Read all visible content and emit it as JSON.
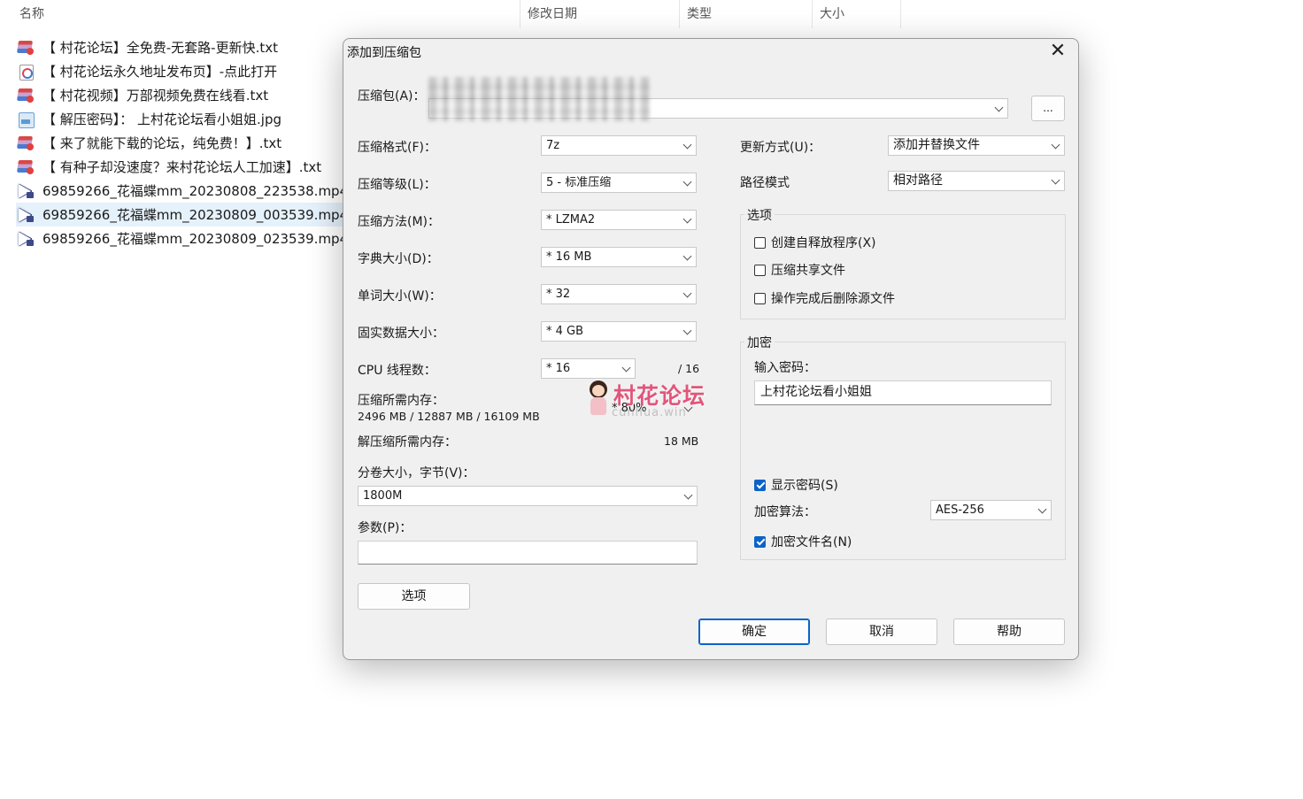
{
  "explorer": {
    "columns": [
      "名称",
      "修改日期",
      "类型",
      "大小"
    ],
    "files": [
      {
        "icon": "rar",
        "name": "【 村花论坛】全免费-无套路-更新快.txt"
      },
      {
        "icon": "html",
        "name": "【 村花论坛永久地址发布页】-点此打开"
      },
      {
        "icon": "rar",
        "name": "【 村花视频】万部视频免费在线看.txt"
      },
      {
        "icon": "jpg",
        "name": "【 解压密码】： 上村花论坛看小姐姐.jpg"
      },
      {
        "icon": "rar",
        "name": "【 来了就能下载的论坛，纯免费！】.txt"
      },
      {
        "icon": "rar",
        "name": "【 有种子却没速度？来村花论坛人工加速】.txt"
      },
      {
        "icon": "mp4",
        "name": "69859266_花福蝶mm_20230808_223538.mp4"
      },
      {
        "icon": "mp4",
        "name": "69859266_花福蝶mm_20230809_003539.mp4",
        "selected": true
      },
      {
        "icon": "mp4",
        "name": "69859266_花福蝶mm_20230809_023539.mp4"
      }
    ]
  },
  "dialog": {
    "title": "添加到压缩包",
    "archive_label": "压缩包(A)：",
    "browse_label": "...",
    "format_label": "压缩格式(F)：",
    "format_value": "7z",
    "level_label": "压缩等级(L)：",
    "level_value": "5 - 标准压缩",
    "method_label": "压缩方法(M)：",
    "method_value": "*  LZMA2",
    "dict_label": "字典大小(D)：",
    "dict_value": "*  16 MB",
    "word_label": "单词大小(W)：",
    "word_value": "*  32",
    "solid_label": "固实数据大小：",
    "solid_value": "*  4 GB",
    "cpu_label": "CPU 线程数：",
    "cpu_value": "*  16",
    "cpu_total": "/ 16",
    "mem_label": "压缩所需内存：",
    "mem_value": "2496 MB / 12887 MB / 16109 MB",
    "mem_percent": "* 80%",
    "decomp_label": "解压缩所需内存：",
    "decomp_value": "18 MB",
    "volume_label": "分卷大小，字节(V)：",
    "volume_value": "1800M",
    "params_label": "参数(P)：",
    "params_value": "",
    "options_button": "选项",
    "update_label": "更新方式(U)：",
    "update_value": "添加并替换文件",
    "path_label": "路径模式",
    "path_value": "相对路径",
    "options_group": "选项",
    "opt_sfx": "创建自释放程序(X)",
    "opt_shared": "压缩共享文件",
    "opt_delete": "操作完成后删除源文件",
    "enc_group": "加密",
    "pwd_label": "输入密码：",
    "pwd_value": "上村花论坛看小姐姐",
    "show_pwd": "显示密码(S)",
    "algo_label": "加密算法：",
    "algo_value": "AES-256",
    "enc_names": "加密文件名(N)",
    "ok": "确定",
    "cancel": "取消",
    "help": "帮助"
  },
  "watermark": {
    "text": "村花论坛",
    "sub": "cunhua.win"
  },
  "colors": {
    "accent": "#0a64c8",
    "dialog_bg": "#f0f0f0",
    "selection": "#e5f1fb",
    "watermark": "#e2557a"
  }
}
